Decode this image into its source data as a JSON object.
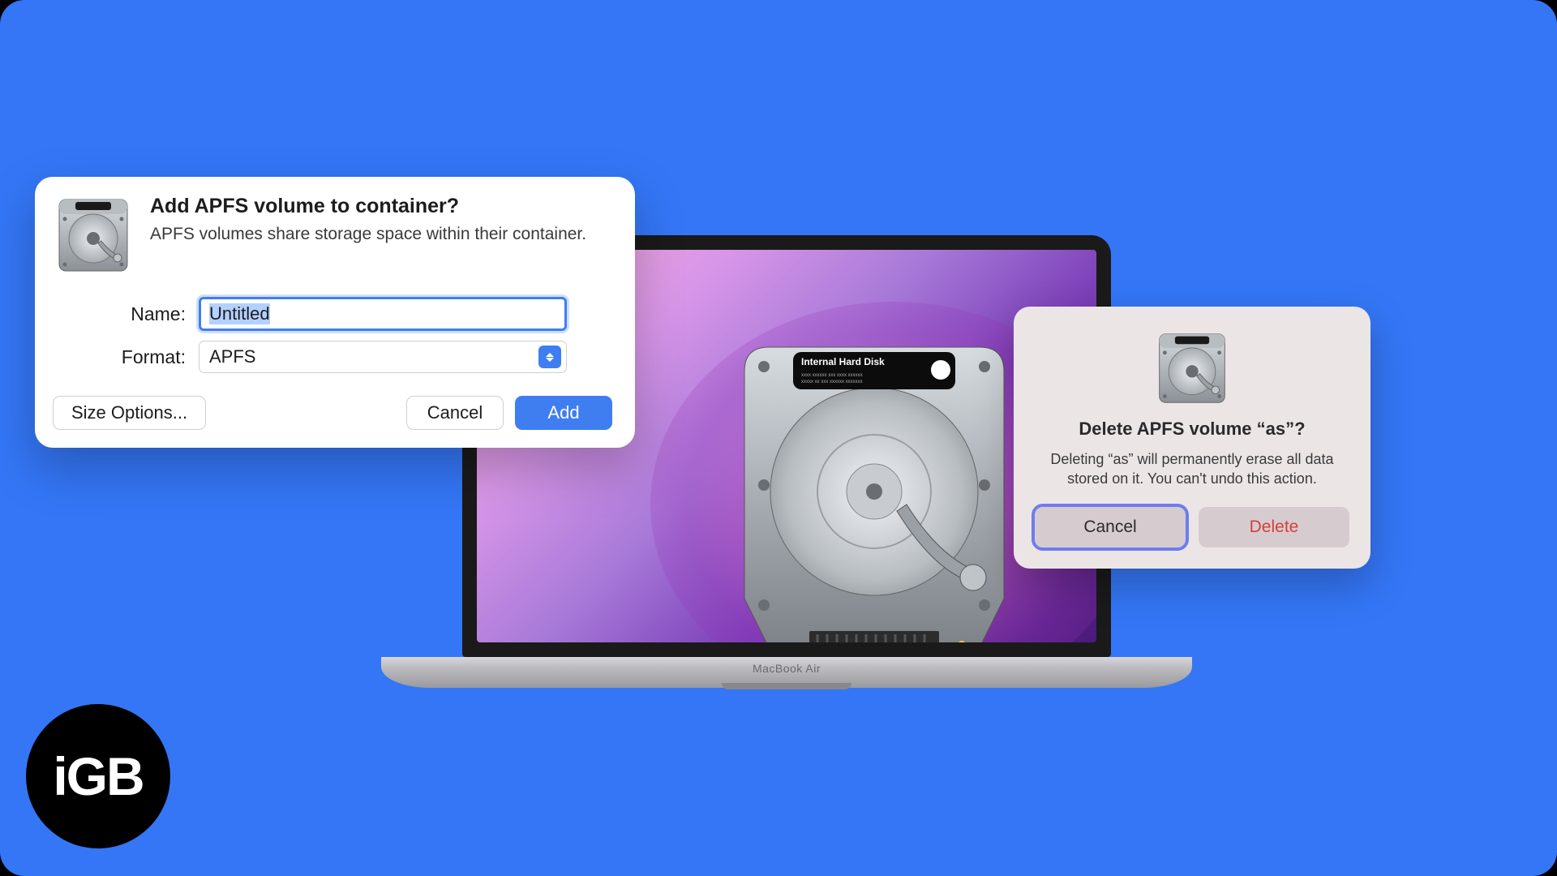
{
  "add_dialog": {
    "title": "Add APFS volume to container?",
    "subtitle": "APFS volumes share storage space within their container.",
    "name_label": "Name:",
    "name_value": "Untitled",
    "format_label": "Format:",
    "format_value": "APFS",
    "size_options": "Size Options...",
    "cancel": "Cancel",
    "add": "Add"
  },
  "delete_dialog": {
    "title": "Delete APFS volume “as”?",
    "body": "Deleting “as” will permanently erase all data stored on it. You can't undo this action.",
    "cancel": "Cancel",
    "delete": "Delete"
  },
  "laptop": {
    "model": "MacBook Air",
    "drive_label": "Internal Hard Disk"
  },
  "brand_badge": "iGB"
}
